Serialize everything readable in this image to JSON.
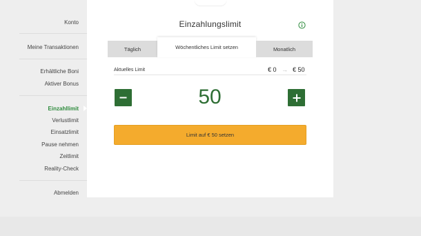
{
  "sidebar": {
    "items": [
      {
        "label": "Konto"
      },
      {
        "label": "Meine Transaktionen"
      },
      {
        "label": "Erhältliche Boni"
      },
      {
        "label": "Aktiver Bonus"
      },
      {
        "label": "Einzahllimit",
        "active": true
      },
      {
        "label": "Verlustlimit"
      },
      {
        "label": "Einsatzlimit"
      },
      {
        "label": "Pause nehmen"
      },
      {
        "label": "Zeitlimit"
      },
      {
        "label": "Reality-Check"
      },
      {
        "label": "Abmelden"
      }
    ]
  },
  "main": {
    "title": "Einzahlungslimit",
    "info_icon": "info-icon",
    "tabs": [
      {
        "label": "Täglich"
      },
      {
        "label": "Wöchentliches Limit setzen",
        "active": true
      },
      {
        "label": "Monatlich"
      }
    ],
    "current_limit": {
      "label": "Aktuelles Limit",
      "from": "€ 0",
      "arrow": "→",
      "to": "€ 50"
    },
    "stepper": {
      "value": "50",
      "minus_icon": "minus-icon",
      "plus_icon": "plus-icon"
    },
    "submit_label": "Limit auf € 50 setzen"
  },
  "colors": {
    "accent_green": "#2e6e34",
    "active_nav_green": "#2e8b3d",
    "button_orange": "#f4ab2d",
    "tab_inactive": "#dcdcdc",
    "background": "#eeeeee"
  }
}
